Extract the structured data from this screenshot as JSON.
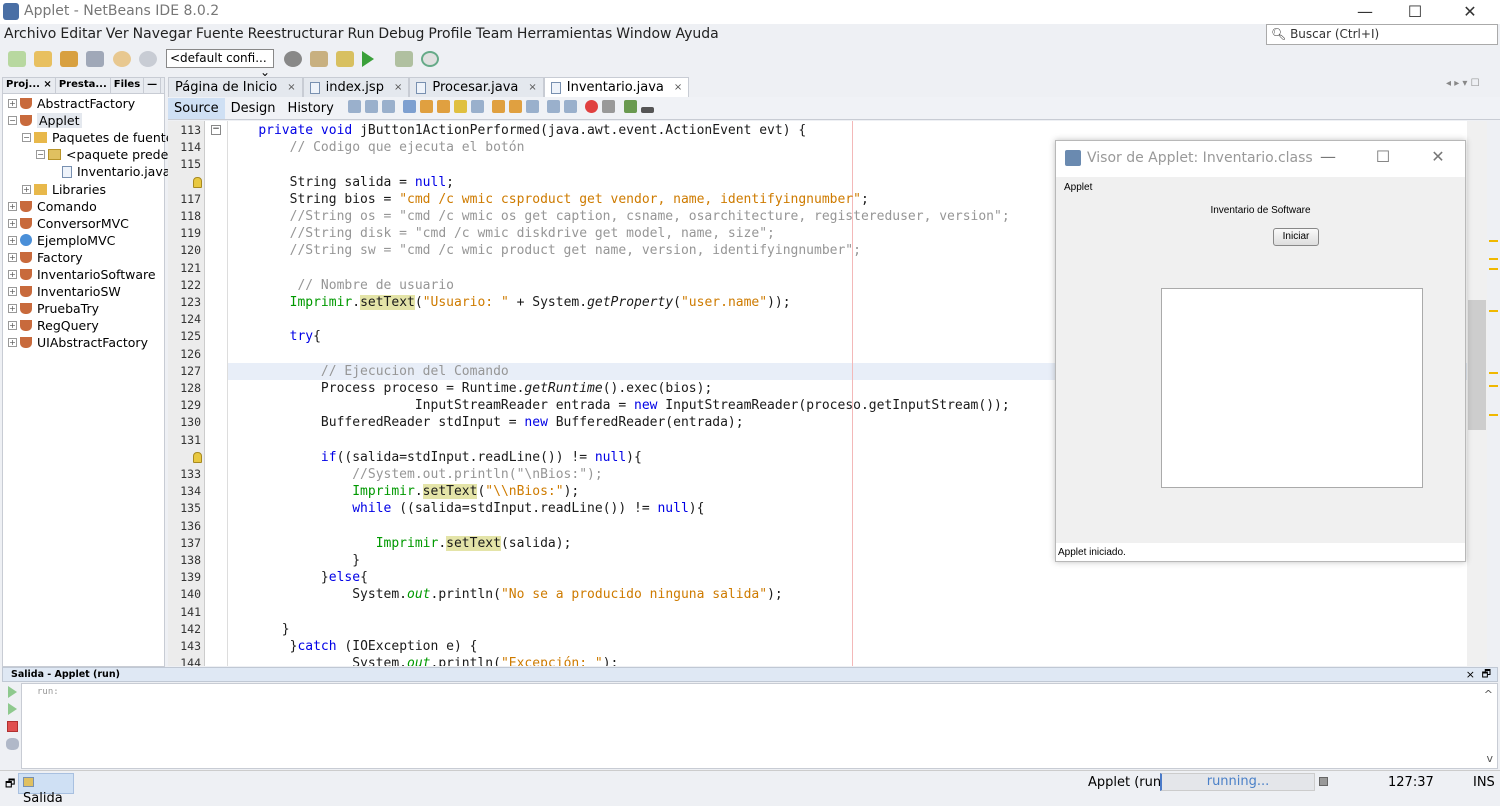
{
  "window": {
    "title": "Applet - NetBeans IDE 8.0.2",
    "min": "—",
    "max": "☐",
    "close": "✕"
  },
  "menu": [
    "Archivo",
    "Editar",
    "Ver",
    "Navegar",
    "Fuente",
    "Reestructurar",
    "Run",
    "Debug",
    "Profile",
    "Team",
    "Herramientas",
    "Window",
    "Ayuda"
  ],
  "search": {
    "placeholder": "Buscar (Ctrl+I)"
  },
  "toolbar": {
    "config": "<default confi..."
  },
  "left_panel": {
    "tabs": [
      "Proj... ×",
      "Presta...",
      "Files",
      "—"
    ],
    "tree": [
      {
        "label": "AbstractFactory",
        "icon": "cup",
        "level": 0,
        "expander": "+"
      },
      {
        "label": "Applet",
        "icon": "cup",
        "level": 0,
        "expander": "−",
        "selected": true
      },
      {
        "label": "Paquetes de fuentes",
        "icon": "folder",
        "level": 1,
        "expander": "−"
      },
      {
        "label": "<paquete predete",
        "icon": "pkg",
        "level": 2,
        "expander": "−"
      },
      {
        "label": "Inventario.java",
        "icon": "file",
        "level": 3,
        "expander": ""
      },
      {
        "label": "Libraries",
        "icon": "folder",
        "level": 1,
        "expander": "+"
      },
      {
        "label": "Comando",
        "icon": "cup",
        "level": 0,
        "expander": "+"
      },
      {
        "label": "ConversorMVC",
        "icon": "cup",
        "level": 0,
        "expander": "+"
      },
      {
        "label": "EjemploMVC",
        "icon": "globe",
        "level": 0,
        "expander": "+"
      },
      {
        "label": "Factory",
        "icon": "cup",
        "level": 0,
        "expander": "+"
      },
      {
        "label": "InventarioSoftware",
        "icon": "cup",
        "level": 0,
        "expander": "+"
      },
      {
        "label": "InventarioSW",
        "icon": "cup",
        "level": 0,
        "expander": "+"
      },
      {
        "label": "PruebaTry",
        "icon": "cup",
        "level": 0,
        "expander": "+"
      },
      {
        "label": "RegQuery",
        "icon": "cup",
        "level": 0,
        "expander": "+"
      },
      {
        "label": "UIAbstractFactory",
        "icon": "cup",
        "level": 0,
        "expander": "+"
      }
    ]
  },
  "editor_tabs": [
    {
      "label": "Página de Inicio",
      "active": false
    },
    {
      "label": "index.jsp",
      "active": false
    },
    {
      "label": "Procesar.java",
      "active": false
    },
    {
      "label": "Inventario.java",
      "active": true
    }
  ],
  "editor_subtabs": [
    "Source",
    "Design",
    "History"
  ],
  "current_line": 127,
  "code": [
    {
      "n": "113",
      "fold": true,
      "t": [
        [
          "",
          "    "
        ],
        [
          "k",
          "private void "
        ],
        [
          "",
          "jButton1ActionPerformed(java.awt.event.ActionEvent evt) {"
        ]
      ]
    },
    {
      "n": "114",
      "t": [
        [
          "c",
          "        // Codigo que ejecuta el botón"
        ]
      ]
    },
    {
      "n": "115",
      "t": []
    },
    {
      "n": "",
      "hint": true,
      "t": [
        [
          "",
          "        String salida = "
        ],
        [
          "k",
          "null"
        ],
        [
          "",
          ";"
        ]
      ]
    },
    {
      "n": "117",
      "t": [
        [
          "",
          "        String bios = "
        ],
        [
          "s",
          "\"cmd /c wmic csproduct get vendor, name, identifyingnumber\""
        ],
        [
          "",
          ";"
        ]
      ]
    },
    {
      "n": "118",
      "t": [
        [
          "c",
          "        //String os = \"cmd /c wmic os get caption, csname, osarchitecture, registereduser, version\";"
        ]
      ]
    },
    {
      "n": "119",
      "t": [
        [
          "c",
          "        //String disk = \"cmd /c wmic diskdrive get model, name, size\";"
        ]
      ]
    },
    {
      "n": "120",
      "t": [
        [
          "c",
          "        //String sw = \"cmd /c wmic product get name, version, identifyingnumber\";"
        ]
      ]
    },
    {
      "n": "121",
      "t": []
    },
    {
      "n": "122",
      "t": [
        [
          "c",
          "         // Nombre de usuario"
        ]
      ]
    },
    {
      "n": "123",
      "t": [
        [
          "f",
          "        Imprimir"
        ],
        [
          "",
          "."
        ],
        [
          "h",
          "setText"
        ],
        [
          "",
          "("
        ],
        [
          "s",
          "\"Usuario: \""
        ],
        [
          "",
          " + System."
        ],
        [
          "i",
          "getProperty"
        ],
        [
          "",
          "("
        ],
        [
          "s",
          "\"user.name\""
        ],
        [
          "",
          "));"
        ]
      ]
    },
    {
      "n": "124",
      "t": []
    },
    {
      "n": "125",
      "t": [
        [
          "k",
          "        try"
        ],
        [
          "",
          "{"
        ]
      ]
    },
    {
      "n": "126",
      "t": []
    },
    {
      "n": "127",
      "t": [
        [
          "c",
          "            // Ejecucion del Comando"
        ]
      ]
    },
    {
      "n": "128",
      "t": [
        [
          "",
          "            Process proceso = Runtime."
        ],
        [
          "i",
          "getRuntime"
        ],
        [
          "",
          "().exec(bios);"
        ]
      ]
    },
    {
      "n": "129",
      "t": [
        [
          "",
          "                        InputStreamReader entrada = "
        ],
        [
          "k",
          "new"
        ],
        [
          "",
          " InputStreamReader(proceso.getInputStream());"
        ]
      ]
    },
    {
      "n": "130",
      "t": [
        [
          "",
          "            BufferedReader stdInput = "
        ],
        [
          "k",
          "new"
        ],
        [
          "",
          " BufferedReader(entrada);"
        ]
      ]
    },
    {
      "n": "131",
      "t": []
    },
    {
      "n": "",
      "hint": true,
      "t": [
        [
          "k",
          "            if"
        ],
        [
          "",
          "((salida=stdInput.readLine()) != "
        ],
        [
          "k",
          "null"
        ],
        [
          "",
          "){"
        ]
      ]
    },
    {
      "n": "133",
      "t": [
        [
          "c",
          "                //System.out.println(\"\\nBios:\");"
        ]
      ]
    },
    {
      "n": "134",
      "t": [
        [
          "f",
          "                Imprimir"
        ],
        [
          "",
          "."
        ],
        [
          "h",
          "setText"
        ],
        [
          "",
          "("
        ],
        [
          "s",
          "\"\\\\nBios:\""
        ],
        [
          "",
          ");"
        ]
      ]
    },
    {
      "n": "135",
      "t": [
        [
          "k",
          "                while"
        ],
        [
          "",
          " ((salida=stdInput.readLine()) != "
        ],
        [
          "k",
          "null"
        ],
        [
          "",
          "){"
        ]
      ]
    },
    {
      "n": "136",
      "t": []
    },
    {
      "n": "137",
      "t": [
        [
          "f",
          "                   Imprimir"
        ],
        [
          "",
          "."
        ],
        [
          "h",
          "setText"
        ],
        [
          "",
          "(salida);"
        ]
      ]
    },
    {
      "n": "138",
      "t": [
        [
          "",
          "                }"
        ]
      ]
    },
    {
      "n": "139",
      "t": [
        [
          "",
          "            }"
        ],
        [
          "k",
          "else"
        ],
        [
          "",
          "{"
        ]
      ]
    },
    {
      "n": "140",
      "t": [
        [
          "",
          "                System."
        ],
        [
          "fi",
          "out"
        ],
        [
          "",
          ".println("
        ],
        [
          "s",
          "\"No se a producido ninguna salida\""
        ],
        [
          "",
          ");"
        ]
      ]
    },
    {
      "n": "141",
      "t": []
    },
    {
      "n": "142",
      "t": [
        [
          "",
          "       }"
        ]
      ]
    },
    {
      "n": "143",
      "t": [
        [
          "",
          "        }"
        ],
        [
          "k",
          "catch"
        ],
        [
          "",
          " (IOException e) {"
        ]
      ]
    },
    {
      "n": "144",
      "t": [
        [
          "",
          "                System."
        ],
        [
          "fi",
          "out"
        ],
        [
          "",
          ".println("
        ],
        [
          "s",
          "\"Excepción: \""
        ],
        [
          "",
          ");"
        ]
      ]
    }
  ],
  "output": {
    "title": "Salida - Applet (run)",
    "text": "run:",
    "close": "×",
    "restore": "🗗",
    "scroll_up": "^",
    "scroll_down": "v"
  },
  "statusbar": {
    "tab": "Salida",
    "task": "Applet (run)",
    "progress_text": "running...",
    "position": "127:37",
    "mode": "INS"
  },
  "applet_viewer": {
    "title": "Visor de Applet: Inventario.class",
    "menu": "Applet",
    "heading": "Inventario de Software",
    "button": "Iniciar",
    "status": "Applet iniciado.",
    "min": "—",
    "max": "☐",
    "close": "✕"
  },
  "colors": {
    "keyword": "#0000e6",
    "comment": "#969696",
    "string": "#ce7b00",
    "field": "#009900",
    "highlight": "#e4e4a8",
    "selected_tab": "#cfe0f4"
  }
}
